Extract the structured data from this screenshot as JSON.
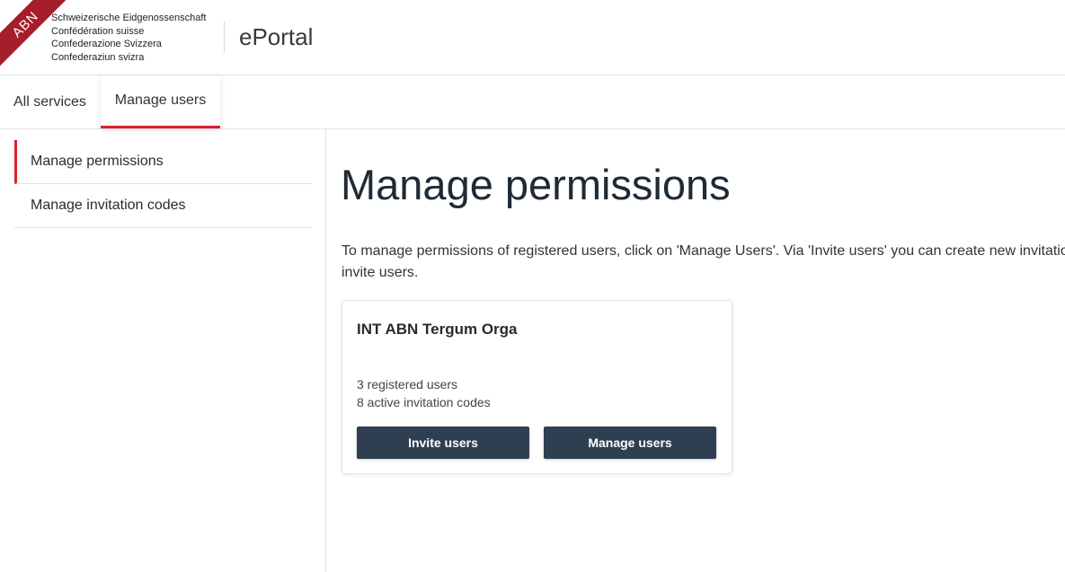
{
  "header": {
    "ribbon_text": "ABN",
    "federation_lines": [
      "Schweizerische Eidgenossenschaft",
      "Confédération suisse",
      "Confederazione Svizzera",
      "Confederaziun svizra"
    ],
    "app_name": "ePortal"
  },
  "tabs": [
    {
      "label": "All services",
      "active": false
    },
    {
      "label": "Manage users",
      "active": true
    }
  ],
  "sidebar": {
    "items": [
      {
        "label": "Manage permissions",
        "active": true
      },
      {
        "label": "Manage invitation codes",
        "active": false
      }
    ]
  },
  "main": {
    "title": "Manage permissions",
    "description_line1": "To manage permissions of registered users, click on 'Manage Users'. Via 'Invite users' you can create new invitatio",
    "description_line2": "invite users."
  },
  "card": {
    "title": "INT ABN Tergum Orga",
    "registered_users": "3 registered users",
    "active_codes": "8 active invitation codes",
    "invite_button": "Invite users",
    "manage_button": "Manage users"
  },
  "colors": {
    "accent_red": "#d8232a",
    "ribbon_red": "#a51e2a",
    "button_dark": "#2f3f52"
  }
}
